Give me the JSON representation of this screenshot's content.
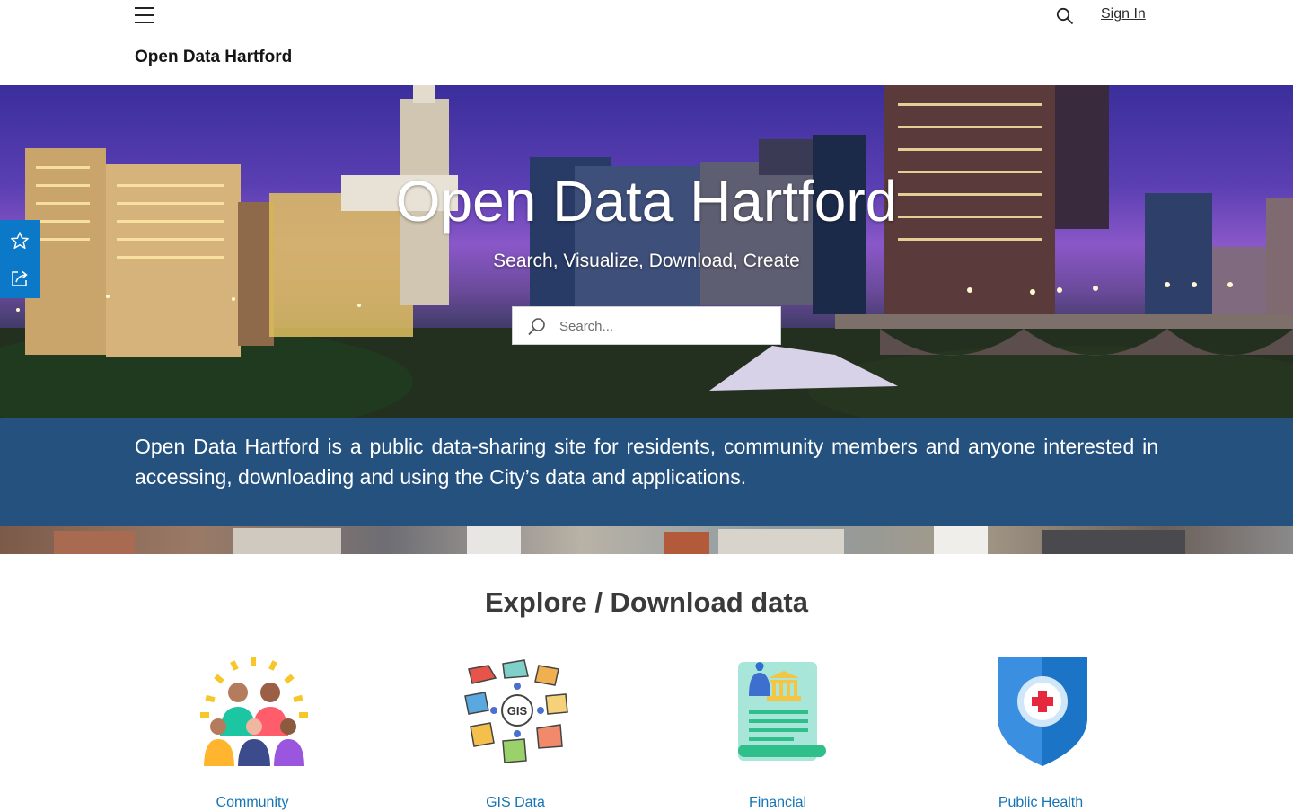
{
  "header": {
    "site_title": "Open Data Hartford",
    "sign_in_label": "Sign In"
  },
  "hero": {
    "title": "Open Data Hartford",
    "subtitle": "Search, Visualize, Download, Create",
    "search_placeholder": "Search..."
  },
  "side_tools": {
    "favorite_icon": "star-icon",
    "share_icon": "share-icon",
    "color": "#0b79c8"
  },
  "intro": {
    "text": "Open Data Hartford is a public data-sharing site for residents, community members and anyone interested in accessing, downloading and using the City’s data and applications.",
    "band_color": "#24517e"
  },
  "explore": {
    "title": "Explore / Download data",
    "categories": [
      {
        "label": "Community",
        "icon": "community-people-icon"
      },
      {
        "label": "GIS Data",
        "icon": "gis-map-icon"
      },
      {
        "label": "Financial",
        "icon": "financial-document-icon"
      },
      {
        "label": "Public Health",
        "icon": "health-shield-icon"
      }
    ],
    "link_color": "#1474b4"
  }
}
